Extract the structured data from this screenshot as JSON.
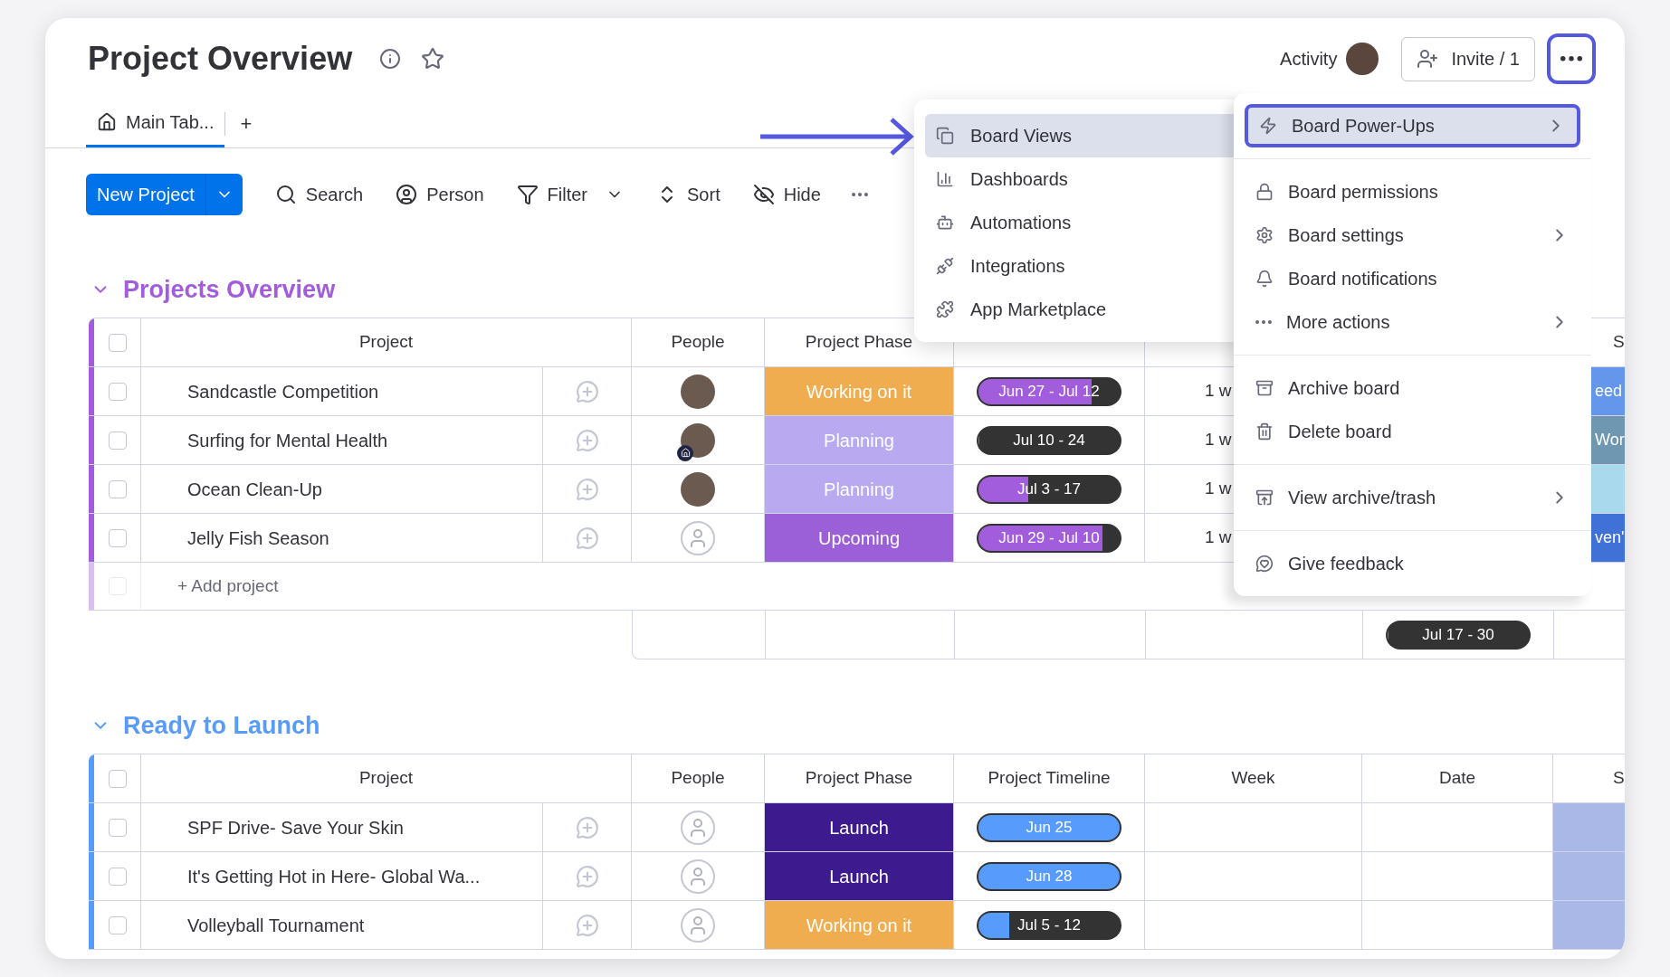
{
  "header": {
    "title": "Project Overview",
    "activity_label": "Activity",
    "invite_label": "Invite / 1",
    "more_selected": true
  },
  "tabs": [
    {
      "label": "Main Tab...",
      "selected": true
    }
  ],
  "add_tab": "+",
  "toolbar": {
    "new_button": "New Project",
    "tools": [
      {
        "label": "Search"
      },
      {
        "label": "Person"
      },
      {
        "label": "Filter",
        "dropdown": true
      },
      {
        "label": "Sort"
      },
      {
        "label": "Hide"
      }
    ]
  },
  "groups": [
    {
      "title": "Projects Overview",
      "color": "#a25ddc",
      "header_checked": false,
      "columns": {
        "project": "Project",
        "people": "People",
        "phase": "Project Phase",
        "status": "S"
      },
      "rows": [
        {
          "checked": false,
          "project": "Sandcastle Competition",
          "has_photo": true,
          "phase": {
            "label": "Working on it",
            "color": "#f0ad4f"
          },
          "timeline": {
            "label": "Jun 27 - Jul 12",
            "level": 0.8
          },
          "week": "1 w",
          "status": {
            "label": "eed",
            "color": "#6497ec"
          }
        },
        {
          "checked": false,
          "project": "Surfing for Mental Health",
          "has_photo": true,
          "home_badge": true,
          "phase": {
            "label": "Planning",
            "color": "#b8a9f1"
          },
          "timeline": {
            "label": "Jul 10 - 24",
            "level": 0
          },
          "week": "1 w",
          "status": {
            "label": "Wor",
            "color": "#7097b2"
          }
        },
        {
          "checked": false,
          "project": "Ocean Clean-Up",
          "has_photo": true,
          "phase": {
            "label": "Planning",
            "color": "#b8a9f1"
          },
          "timeline": {
            "label": "Jul 3 - 17",
            "level": 0.35
          },
          "week": "1 w",
          "status": {
            "color": "#a9d9ec"
          }
        },
        {
          "checked": false,
          "project": "Jelly Fish Season",
          "has_photo": false,
          "phase": {
            "label": "Upcoming",
            "color": "#9b5fd8"
          },
          "timeline": {
            "label": "Jun 29 - Jul 10",
            "level": 0.88
          },
          "week": "1 w",
          "status": {
            "label": "ven'",
            "color": "#3f71d6"
          }
        }
      ],
      "add_checked": false,
      "add_label": "+ Add project",
      "summary": {
        "date": "Jul 17 - 30",
        "level": 0
      }
    },
    {
      "title": "Ready to Launch",
      "color": "#579bfc",
      "header_checked": false,
      "columns": {
        "project": "Project",
        "people": "People",
        "phase": "Project Phase",
        "timeline": "Project Timeline",
        "week": "Week",
        "date": "Date",
        "status": "S"
      },
      "rows": [
        {
          "checked": false,
          "project": "SPF Drive- Save Your Skin",
          "has_photo": false,
          "phase": {
            "label": "Launch",
            "color": "#3d1a8e"
          },
          "timeline": {
            "label": "Jun 25",
            "level": 1
          },
          "status": {
            "color": "#a9b8e6"
          }
        },
        {
          "checked": false,
          "project": "It's Getting Hot in Here- Global Wa...",
          "has_photo": false,
          "phase": {
            "label": "Launch",
            "color": "#3d1a8e"
          },
          "timeline": {
            "label": "Jun 28",
            "level": 1
          },
          "status": {
            "color": "#a9b8e6"
          }
        },
        {
          "checked": false,
          "project": "Volleyball Tournament",
          "has_photo": false,
          "phase": {
            "label": "Working on it",
            "color": "#f0ad4f"
          },
          "timeline": {
            "label": "Jul 5 - 12",
            "level": 0.22
          },
          "status": {
            "color": "#a9b8e6"
          }
        }
      ]
    }
  ],
  "views_menu": {
    "items": [
      {
        "label": "Board Views",
        "selected": true
      },
      {
        "label": "Dashboards",
        "selected": false
      },
      {
        "label": "Automations",
        "selected": false
      },
      {
        "label": "Integrations",
        "selected": false
      },
      {
        "label": "App Marketplace",
        "selected": false
      }
    ]
  },
  "board_menu": {
    "sections": [
      [
        {
          "label": "Board Power-Ups",
          "selected": true,
          "submenu": true
        }
      ],
      [
        {
          "label": "Board permissions",
          "selected": false,
          "submenu": false
        },
        {
          "label": "Board settings",
          "selected": false,
          "submenu": true
        },
        {
          "label": "Board notifications",
          "selected": false,
          "submenu": false
        },
        {
          "label": "More actions",
          "selected": false,
          "submenu": true
        }
      ],
      [
        {
          "label": "Archive board",
          "selected": false,
          "submenu": false
        },
        {
          "label": "Delete board",
          "selected": false,
          "submenu": false
        }
      ],
      [
        {
          "label": "View archive/trash",
          "selected": false,
          "submenu": true
        }
      ],
      [
        {
          "label": "Give feedback",
          "selected": false,
          "submenu": false
        }
      ]
    ]
  }
}
